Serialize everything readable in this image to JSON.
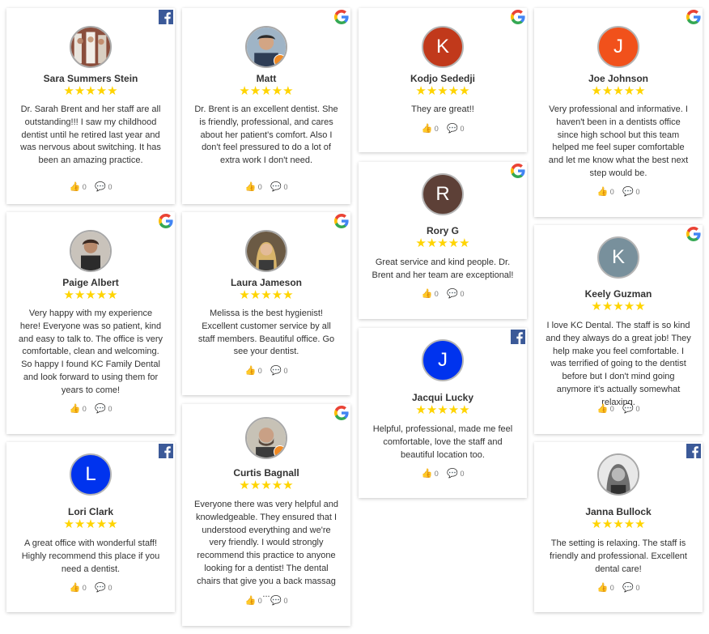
{
  "colors": {
    "star": "#ffd400",
    "facebook": "#3b5998"
  },
  "reviews": [
    {
      "name": "Sara Summers Stein",
      "source": "facebook",
      "avatar": "photo",
      "text": "Dr. Sarah Brent and her staff are all outstanding!!! I saw my childhood dentist until he retired last year and was nervous about switching. It has been an amazing practice.",
      "likes": "0",
      "comments": "0"
    },
    {
      "name": "Matt",
      "source": "google",
      "avatar": "photo",
      "text": "Dr. Brent is an excellent dentist. She is friendly, professional, and cares about her patient's comfort. Also I don't feel pressured to do a lot of extra work I don't need.",
      "likes": "0",
      "comments": "0"
    },
    {
      "name": "Kodjo Sededji",
      "source": "google",
      "avatar": "K",
      "text": "They are great!!",
      "likes": "0",
      "comments": "0"
    },
    {
      "name": "Joe Johnson",
      "source": "google",
      "avatar": "J",
      "text": "Very professional and informative. I haven't been in a dentists office since high school but this team helped me feel super comfortable and let me know what the best next step would be.",
      "likes": "0",
      "comments": "0"
    },
    {
      "name": "Paige Albert",
      "source": "google",
      "avatar": "photo",
      "text": "Very happy with my experience here! Everyone was so patient, kind and easy to talk to. The office is very comfortable, clean and welcoming. So happy I found KC Family Dental and look forward to using them for years to come!",
      "likes": "0",
      "comments": "0"
    },
    {
      "name": "Laura Jameson",
      "source": "google",
      "avatar": "photo",
      "text": "Melissa is the best hygienist! Excellent customer service by all staff members. Beautiful office. Go see your dentist.",
      "likes": "0",
      "comments": "0"
    },
    {
      "name": "Rory G",
      "source": "google",
      "avatar": "R",
      "text": "Great service and kind people. Dr. Brent and her team are exceptional!",
      "likes": "0",
      "comments": "0"
    },
    {
      "name": "Keely Guzman",
      "source": "google",
      "avatar": "K",
      "text": "I love KC Dental. The staff is so kind and they always do a great job! They help make you feel comfortable. I was terrified of going to the dentist before but I don't mind going anymore it's actually somewhat relaxing.",
      "likes": "0",
      "comments": "0"
    },
    {
      "name": "Jacqui Lucky",
      "source": "facebook",
      "avatar": "J",
      "text": "Helpful, professional, made me feel comfortable, love the staff and beautiful location too.",
      "likes": "0",
      "comments": "0"
    },
    {
      "name": "Lori Clark",
      "source": "facebook",
      "avatar": "L",
      "text": "A great office with wonderful staff! Highly recommend this place if you need a dentist.",
      "likes": "0",
      "comments": "0"
    },
    {
      "name": "Curtis Bagnall",
      "source": "google",
      "avatar": "photo",
      "text": "Everyone there was very helpful and knowledgeable. They ensured that I understood everything and we're very friendly. I would strongly recommend this practice to anyone looking for a dentist! The dental chairs that give you a back massag ...",
      "likes": "0",
      "comments": "0"
    },
    {
      "name": "Janna Bullock",
      "source": "facebook",
      "avatar": "photo",
      "text": "The setting is relaxing. The staff is friendly and professional. Excellent dental care!",
      "likes": "0",
      "comments": "0"
    }
  ],
  "stars_symbol": "★★★★★"
}
